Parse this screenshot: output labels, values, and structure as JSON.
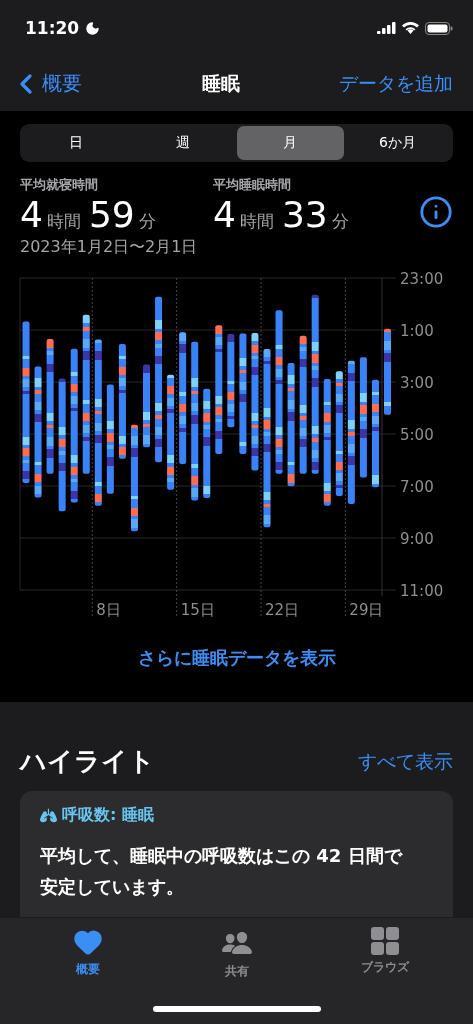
{
  "status_bar": {
    "time": "11:20"
  },
  "nav": {
    "back": "概要",
    "title": "睡眠",
    "action": "データを追加"
  },
  "segments": [
    {
      "label": "日",
      "selected": false
    },
    {
      "label": "週",
      "selected": false
    },
    {
      "label": "月",
      "selected": true
    },
    {
      "label": "6か月",
      "selected": false
    }
  ],
  "stats": [
    {
      "label": "平均就寝時間",
      "hours": "4",
      "hours_unit": "時間",
      "minutes": "59",
      "minutes_unit": "分"
    },
    {
      "label": "平均睡眠時間",
      "hours": "4",
      "hours_unit": "時間",
      "minutes": "33",
      "minutes_unit": "分"
    }
  ],
  "date_range": "2023年1月2日〜2月1日",
  "chart": {
    "y_axis_labels": [
      "23:00",
      "1:00",
      "3:00",
      "5:00",
      "7:00",
      "9:00",
      "11:00"
    ],
    "x_axis_labels": [
      "8日",
      "15日",
      "22日",
      "29日"
    ]
  },
  "more_link": "さらに睡眠データを表示",
  "highlights": {
    "title": "ハイライト",
    "see_all": "すべて表示",
    "card": {
      "heading": "呼吸数: 睡眠",
      "body": "平均して、睡眠中の呼吸数はこの 42 日間で安定しています。"
    }
  },
  "tab_bar": [
    {
      "label": "概要",
      "selected": true,
      "kind": "heart"
    },
    {
      "label": "共有",
      "selected": false,
      "kind": "people"
    },
    {
      "label": "ブラウズ",
      "selected": false,
      "kind": "grid"
    }
  ]
}
